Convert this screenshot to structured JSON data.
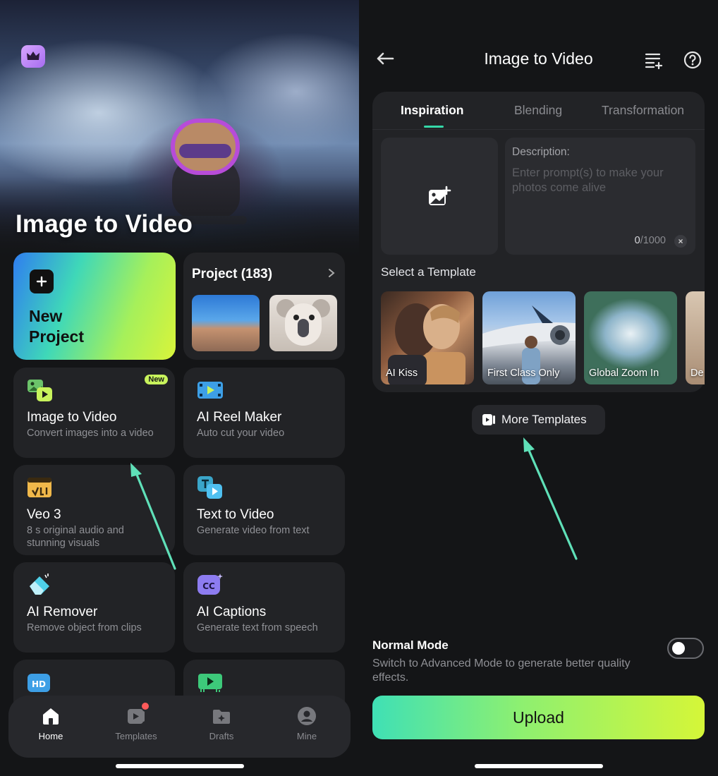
{
  "left": {
    "hero": {
      "title": "Image to Video"
    },
    "new_project": {
      "label_line1": "New",
      "label_line2": "Project"
    },
    "project": {
      "title": "Project (183)"
    },
    "features": [
      {
        "title": "Image to Video",
        "subtitle": "Convert images into a video",
        "badge": "New"
      },
      {
        "title": "AI Reel Maker",
        "subtitle": "Auto cut your video"
      },
      {
        "title": "Veo 3",
        "subtitle": "8 s original audio and stunning visuals"
      },
      {
        "title": "Text to Video",
        "subtitle": "Generate video from text"
      },
      {
        "title": "AI Remover",
        "subtitle": "Remove object from clips"
      },
      {
        "title": "AI Captions",
        "subtitle": "Generate text from speech"
      }
    ],
    "nav": [
      {
        "label": "Home",
        "icon": "home-icon"
      },
      {
        "label": "Templates",
        "icon": "templates-icon"
      },
      {
        "label": "Drafts",
        "icon": "drafts-icon"
      },
      {
        "label": "Mine",
        "icon": "profile-icon"
      }
    ]
  },
  "right": {
    "header": {
      "title": "Image to Video"
    },
    "tabs": [
      "Inspiration",
      "Blending",
      "Transformation"
    ],
    "description": {
      "label": "Description:",
      "placeholder": "Enter prompt(s) to make your photos come alive",
      "count_current": "0",
      "count_max": "/1000"
    },
    "select_template_label": "Select a Template",
    "templates": [
      "AI Kiss",
      "First Class Only",
      "Global Zoom In",
      "De"
    ],
    "more_templates_label": "More Templates",
    "mode": {
      "title": "Normal Mode",
      "subtitle": "Switch to Advanced Mode to generate better quality effects."
    },
    "upload_label": "Upload"
  },
  "colors": {
    "accent_teal": "#35d8a8",
    "accent_lime": "#d5f638",
    "arrow": "#5fe0b8",
    "badge_new": "#c8f35c",
    "notification_dot": "#ff5a5a"
  }
}
